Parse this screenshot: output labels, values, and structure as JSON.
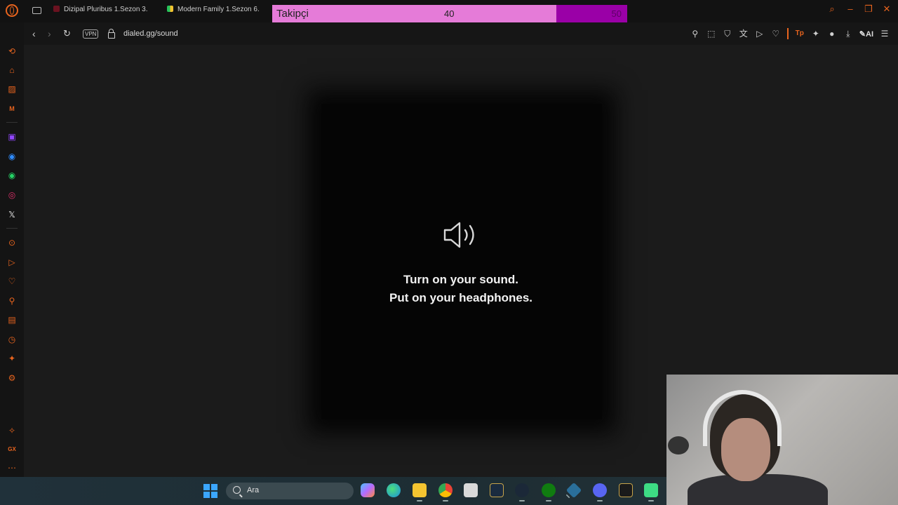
{
  "browser": {
    "tabs": [
      {
        "label": "Dizipal Pluribus 1.Sezon 3."
      },
      {
        "label": "Modern Family 1.Sezon 6."
      }
    ],
    "address": {
      "vpn_label": "VPN",
      "url": "dialed.gg/sound"
    },
    "toolbar": {
      "ai_label": "AI"
    }
  },
  "follower_goal": {
    "label": "Takipçi",
    "current": "40",
    "goal": "50",
    "progress": 0.8,
    "fill_color": "#e57bd8",
    "rest_color": "#9a00a7"
  },
  "page": {
    "line1": "Turn on your sound.",
    "line2": "Put on your headphones."
  },
  "taskbar": {
    "search_placeholder": "Ara"
  },
  "colors": {
    "accent": "#e8641e",
    "page_bg": "#1b1b1b",
    "card_bg": "#050505"
  },
  "icons": {
    "sidebar": [
      "history-icon",
      "bag-icon",
      "stripes-icon",
      "m-icon",
      "twitch-icon",
      "messenger-icon",
      "whatsapp-icon",
      "instagram-icon",
      "x-icon",
      "player-icon",
      "send-icon",
      "heart-icon",
      "pin-icon",
      "tabs-icon",
      "clock-icon",
      "extensions-icon",
      "settings-icon",
      "gx-icon",
      "gx-label",
      "more-icon"
    ],
    "toolbar": [
      "pin-icon",
      "screenshot-icon",
      "shield-icon",
      "translate-icon",
      "send-icon",
      "heart-icon",
      "tp-icon",
      "extensions-icon",
      "profile-icon",
      "download-icon",
      "ai-icon",
      "menu-icon"
    ]
  }
}
